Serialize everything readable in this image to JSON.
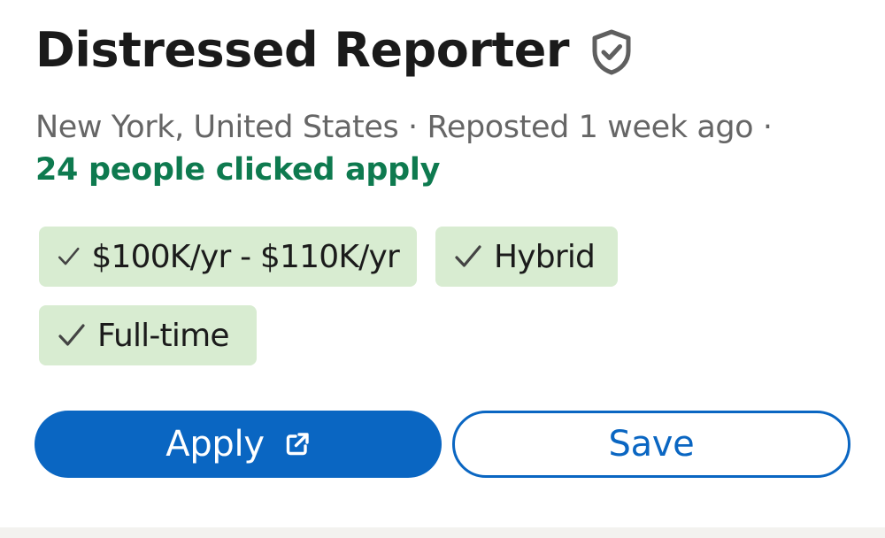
{
  "job": {
    "title": "Distressed Reporter",
    "verified_icon": "shield-check-icon",
    "meta_line": "New York, United States · Reposted 1 week ago ·",
    "applicants_text": "24 people clicked apply"
  },
  "chips": {
    "salary": "$100K/yr - $110K/yr",
    "workplace": "Hybrid",
    "employment_type": "Full-time",
    "check_icon": "checkmark-icon"
  },
  "actions": {
    "apply_label": "Apply",
    "apply_icon": "external-link-icon",
    "save_label": "Save"
  },
  "colors": {
    "accent_blue": "#0a66c2",
    "applicants_green": "#0e7a4f",
    "chip_background": "#d8ecd1",
    "meta_gray": "#666666"
  }
}
